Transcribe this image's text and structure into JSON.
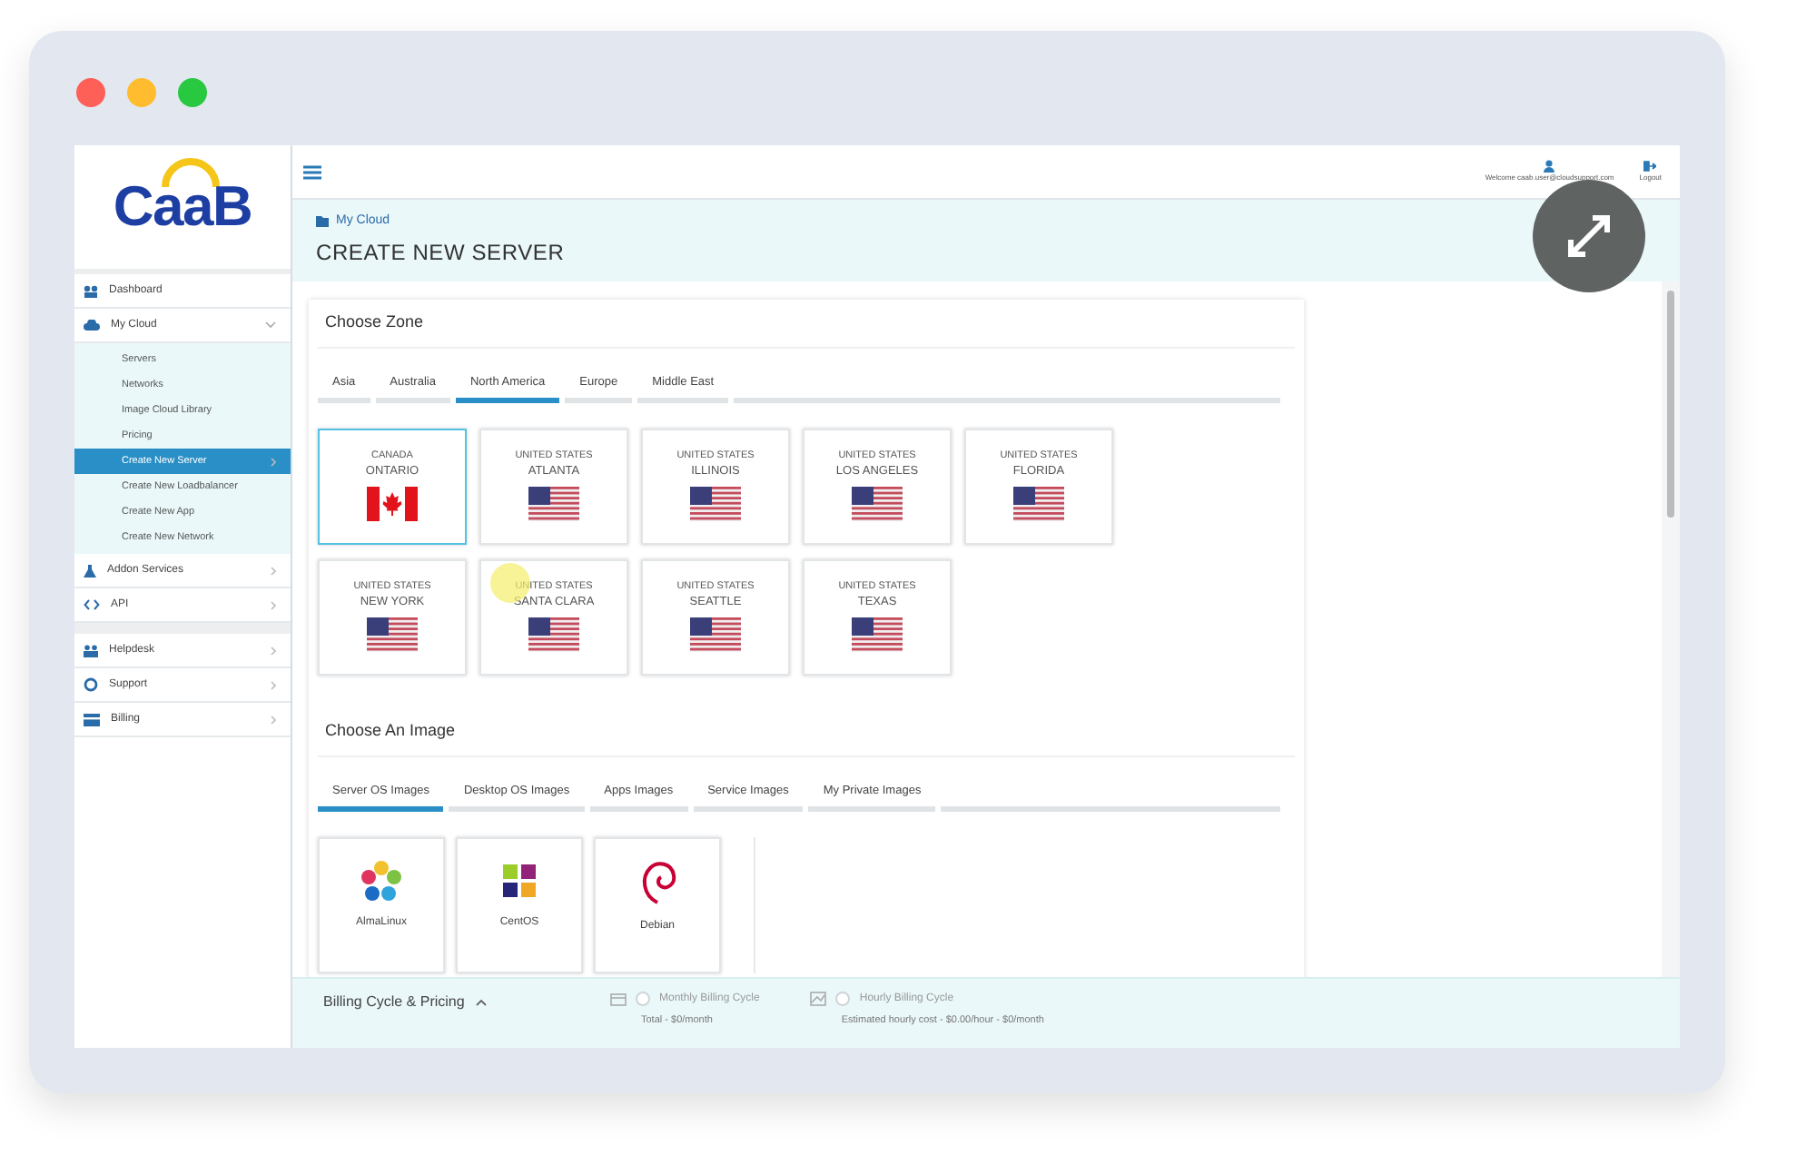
{
  "logo": {
    "text": "CaaB"
  },
  "header": {
    "user": "Welcome caab.user@cloudsupport.com",
    "logout": "Logout"
  },
  "breadcrumb": "My Cloud",
  "page_title": "CREATE NEW SERVER",
  "sidebar": {
    "groups": [
      [
        {
          "label": "Dashboard",
          "selected": false
        },
        {
          "label": "My Cloud",
          "selected": false,
          "expanded": true,
          "children": [
            {
              "label": "Servers",
              "selected": false
            },
            {
              "label": "Networks",
              "selected": false
            },
            {
              "label": "Image Cloud Library",
              "selected": false
            },
            {
              "label": "Pricing",
              "selected": false
            },
            {
              "label": "Create New Server",
              "selected": true
            },
            {
              "label": "Create New Loadbalancer",
              "selected": false
            },
            {
              "label": "Create New App",
              "selected": false
            },
            {
              "label": "Create New Network",
              "selected": false
            }
          ]
        },
        {
          "label": "Addon Services",
          "selected": false,
          "expanded": false
        },
        {
          "label": "API",
          "selected": false,
          "expanded": false
        }
      ],
      [
        {
          "label": "Helpdesk",
          "selected": false,
          "expanded": false
        },
        {
          "label": "Support",
          "selected": false,
          "expanded": false
        },
        {
          "label": "Billing",
          "selected": false,
          "expanded": false
        }
      ]
    ]
  },
  "zone": {
    "title": "Choose Zone",
    "tabs": [
      {
        "label": "Asia",
        "selected": false
      },
      {
        "label": "Australia",
        "selected": false
      },
      {
        "label": "North America",
        "selected": true
      },
      {
        "label": "Europe",
        "selected": false
      },
      {
        "label": "Middle East",
        "selected": false
      }
    ],
    "zones": [
      {
        "country": "CANADA",
        "city": "ONTARIO",
        "kind": "canada",
        "selected": true
      },
      {
        "country": "UNITED STATES",
        "city": "ATLANTA",
        "kind": "usa",
        "selected": false
      },
      {
        "country": "UNITED STATES",
        "city": "ILLINOIS",
        "kind": "usa",
        "selected": false
      },
      {
        "country": "UNITED STATES",
        "city": "LOS ANGELES",
        "kind": "usa",
        "selected": false
      },
      {
        "country": "UNITED STATES",
        "city": "FLORIDA",
        "kind": "usa",
        "selected": false
      },
      {
        "country": "UNITED STATES",
        "city": "NEW YORK",
        "kind": "usa",
        "selected": false
      },
      {
        "country": "UNITED STATES",
        "city": "SANTA CLARA",
        "kind": "usa",
        "selected": false
      },
      {
        "country": "UNITED STATES",
        "city": "SEATTLE",
        "kind": "usa",
        "selected": false
      },
      {
        "country": "UNITED STATES",
        "city": "TEXAS",
        "kind": "usa",
        "selected": false
      }
    ]
  },
  "image": {
    "title": "Choose An Image",
    "tabs": [
      {
        "label": "Server OS Images",
        "selected": true
      },
      {
        "label": "Desktop OS Images",
        "selected": false
      },
      {
        "label": "Apps Images",
        "selected": false
      },
      {
        "label": "Service Images",
        "selected": false
      },
      {
        "label": "My Private Images",
        "selected": false
      }
    ],
    "images": [
      {
        "name": "AlmaLinux",
        "kind": "alma"
      },
      {
        "name": "CentOS",
        "kind": "centos"
      },
      {
        "name": "Debian",
        "kind": "debian"
      }
    ]
  },
  "billing": {
    "title": "Billing Cycle & Pricing",
    "options": [
      {
        "label": "Monthly Billing Cycle",
        "detail": "Total - $0/month",
        "kind": "monthly",
        "checked": false
      },
      {
        "label": "Hourly Billing Cycle",
        "detail": "Estimated hourly cost - $0.00/hour - $0/month",
        "kind": "hourly",
        "checked": false
      }
    ]
  }
}
